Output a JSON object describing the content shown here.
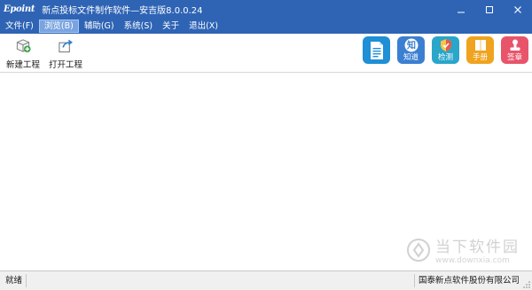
{
  "window": {
    "logo": "Epoint",
    "title": "新点投标文件制作软件—安吉版8.0.0.24",
    "controls": {
      "minimize": "minimize",
      "maximize": "maximize",
      "close": "close"
    }
  },
  "menu": [
    {
      "label": "文件(F)",
      "active": false
    },
    {
      "label": "浏览(B)",
      "active": true
    },
    {
      "label": "辅助(G)",
      "active": false
    },
    {
      "label": "系统(S)",
      "active": false
    },
    {
      "label": "关于",
      "active": false
    },
    {
      "label": "退出(X)",
      "active": false
    }
  ],
  "toolbar": {
    "new_project": {
      "label": "新建工程",
      "icon": "new-project-icon"
    },
    "open_project": {
      "label": "打开工程",
      "icon": "open-project-icon"
    }
  },
  "quick_actions": [
    {
      "label": "",
      "icon": "document-icon",
      "color": "#1f8fd6"
    },
    {
      "label": "知道",
      "icon": "zhidao-icon",
      "color": "#3b7fd1"
    },
    {
      "label": "检测",
      "icon": "shield-check-icon",
      "color": "#29a6c9"
    },
    {
      "label": "手册",
      "icon": "manual-book-icon",
      "color": "#f0a31e"
    },
    {
      "label": "签章",
      "icon": "seal-stamp-icon",
      "color": "#e8546a"
    }
  ],
  "watermark": {
    "main": "当下软件园",
    "sub": "www.downxia.com",
    "icon": "watermark-logo-icon"
  },
  "status": {
    "left": "就绪",
    "right": "国泰新点软件股份有限公司"
  }
}
